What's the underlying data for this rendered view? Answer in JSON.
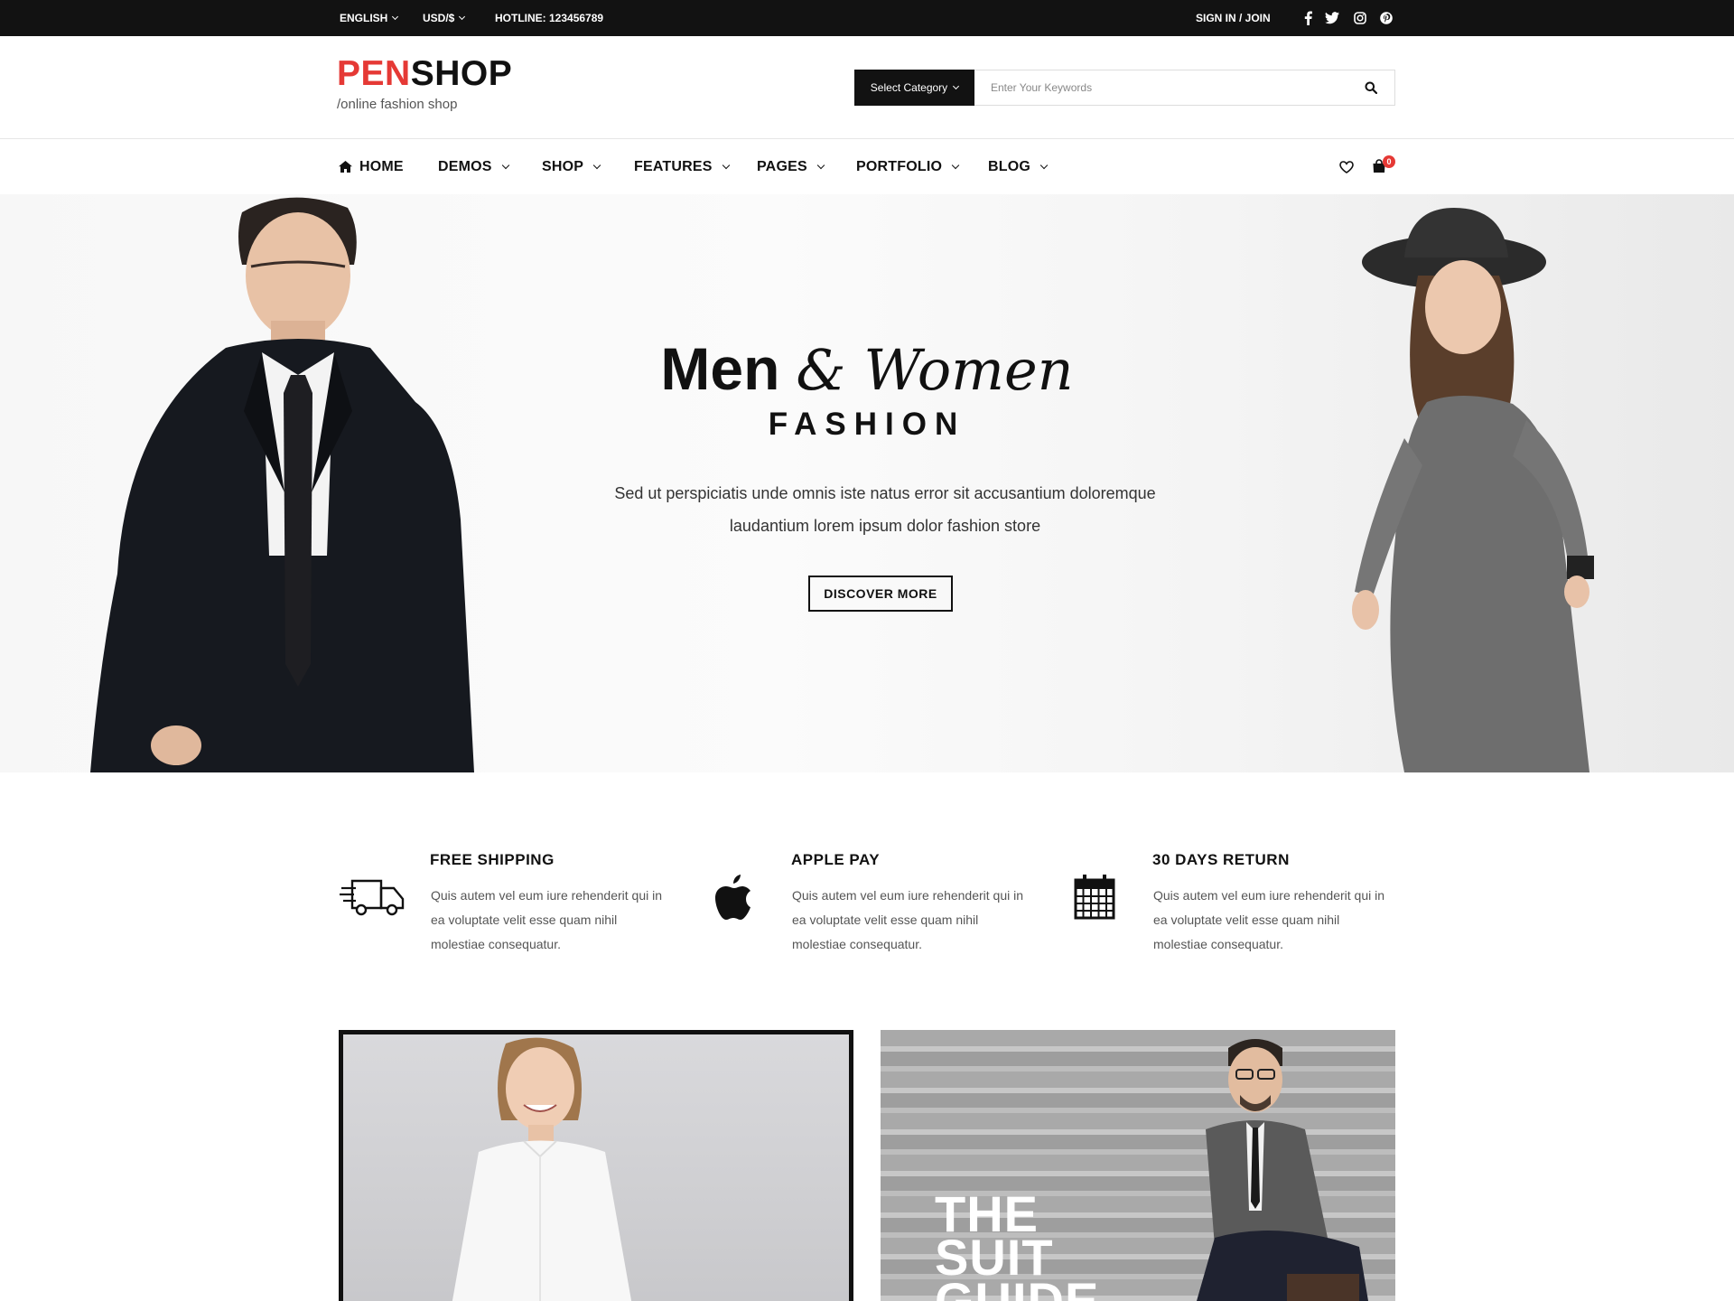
{
  "topbar": {
    "language": "ENGLISH",
    "currency": "USD/$",
    "hotline": "HOTLINE: 123456789",
    "signin": "SIGN IN / JOIN",
    "social_icons": [
      "facebook-icon",
      "twitter-icon",
      "instagram-icon",
      "pinterest-icon"
    ]
  },
  "header": {
    "logo_pen": "PEN",
    "logo_shop": "SHOP",
    "tagline": "/online fashion shop",
    "search": {
      "category_label": "Select Category",
      "placeholder": "Enter Your Keywords",
      "button_icon": "search-icon"
    }
  },
  "nav": {
    "items": [
      {
        "label": "HOME",
        "icon": "home-icon"
      },
      {
        "label": "DEMOS"
      },
      {
        "label": "SHOP"
      },
      {
        "label": "FEATURES"
      },
      {
        "label": "PAGES"
      },
      {
        "label": "PORTFOLIO"
      },
      {
        "label": "BLOG"
      }
    ],
    "cart_count": "0"
  },
  "hero": {
    "title_men": "Men",
    "title_women": "& Women",
    "subtitle": "FASHION",
    "description": "Sed ut perspiciatis unde omnis iste natus error sit accusantium doloremque laudantium lorem ipsum dolor fashion store",
    "button": "DISCOVER MORE"
  },
  "features": [
    {
      "title": "FREE SHIPPING",
      "icon": "truck-icon",
      "text": "Quis autem vel eum iure rehenderit qui in ea voluptate velit esse quam nihil molestiae consequatur."
    },
    {
      "title": "APPLE PAY",
      "icon": "apple-icon",
      "text": "Quis autem vel eum iure rehenderit qui in ea voluptate velit esse quam nihil molestiae consequatur."
    },
    {
      "title": "30 DAYS RETURN",
      "icon": "calendar-icon",
      "text": "Quis autem vel eum iure rehenderit qui in ea voluptate velit esse quam nihil molestiae consequatur."
    }
  ],
  "banners": {
    "right_text": "THE SUIT GUIDE"
  },
  "colors": {
    "accent": "#e53935",
    "dark": "#121212"
  }
}
